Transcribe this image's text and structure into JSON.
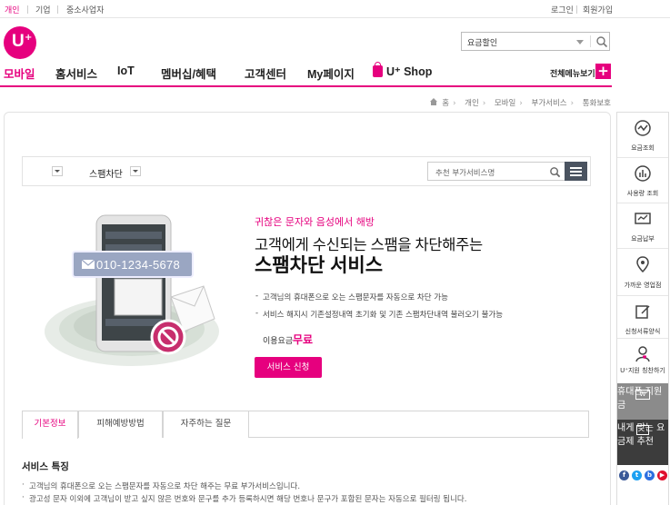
{
  "topbar": {
    "segments": [
      "개인",
      "기업",
      "중소사업자"
    ],
    "util_links": [
      "로그인",
      "회원가입"
    ]
  },
  "search": {
    "value": "요금할인"
  },
  "nav": {
    "items": [
      "모바일",
      "홈서비스",
      "IoT",
      "멤버십/혜택",
      "고객센터",
      "My페이지",
      "U⁺ Shop"
    ],
    "all_menu": "전체메뉴보기"
  },
  "breadcrumb": [
    "홈",
    "개인",
    "모바일",
    "부가서비스",
    "통화보호"
  ],
  "subbar": {
    "title": "스팸차단",
    "search_placeholder": "추천 부가서비스명"
  },
  "hero": {
    "phone_number": "010-1234-5678",
    "eyebrow": "귀찮은 문자와 음성에서 해방",
    "title_line1": "고객에게 수신되는 스팸을 차단해주는",
    "title_line2": "스팸차단 서비스",
    "bullets": [
      "고객님의 휴대폰으로 오는 스팸문자를 자동으로 차단 가능",
      "서비스 해지시 기존설정내역 초기화 및 기존 스팸차단내역 불러오기 불가능"
    ],
    "fee_label": "이용요금",
    "fee_value": "무료",
    "apply_button": "서비스 신청"
  },
  "tabs": [
    "기본정보",
    "피해예방방법",
    "자주하는 질문"
  ],
  "features": {
    "title": "서비스 특징",
    "lines": [
      "고객님의 휴대폰으로 오는 스팸문자를 자동으로 차단 해주는 무료 부가서비스입니다.",
      "광고성 문자 이외에 고객님이 받고 싶지 않은 번호와 문구를 추가 등록하시면 해당 번호나 문구가 포함된 문자는 자동으로 필터링 됩니다."
    ]
  },
  "quick_menu": {
    "items": [
      "요금조회",
      "사용량 조회",
      "요금납부",
      "가까운 영업점",
      "신청서류양식",
      "U⁺지원 칭찬하기"
    ],
    "gray_item": "휴대폰 지원금",
    "dark_item_line1": "내게 맞는",
    "dark_item_line2": "요금제 추천"
  },
  "colors": {
    "brand": "#e6007e",
    "dark": "#3c3c3c",
    "gray": "#8b8b8b"
  }
}
